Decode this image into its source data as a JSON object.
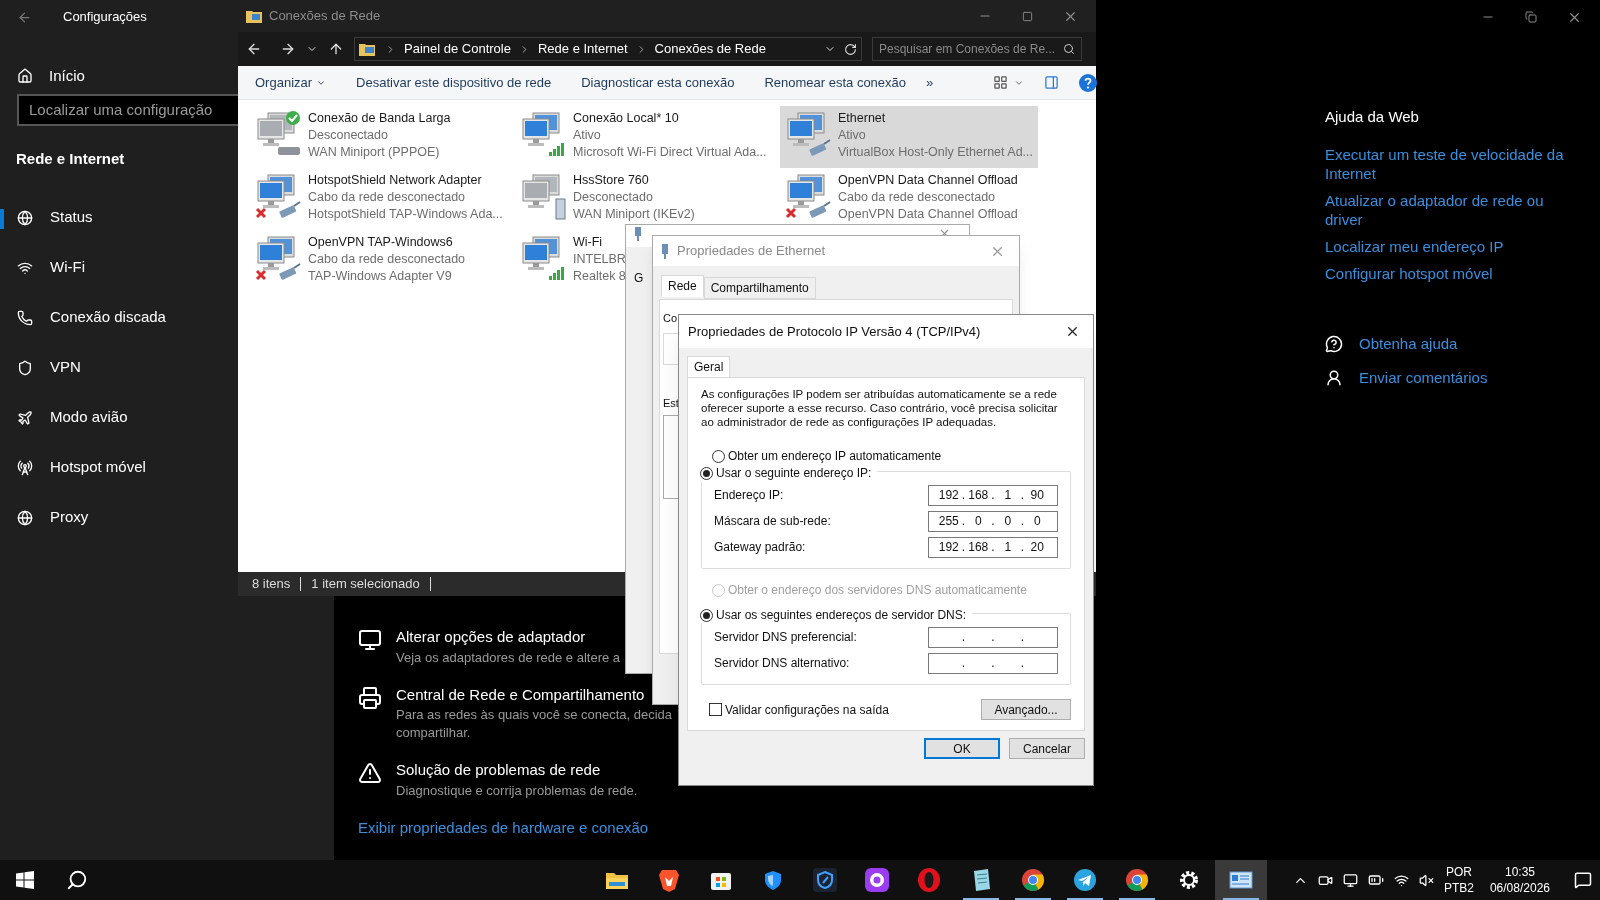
{
  "settings": {
    "title": "Configurações",
    "home": "Início",
    "search": {
      "placeholder": "Localizar uma configuração"
    },
    "section": "Rede e Internet",
    "nav": [
      {
        "label": "Status",
        "selected": true
      },
      {
        "label": "Wi-Fi",
        "selected": false
      },
      {
        "label": "Conexão discada",
        "selected": false
      },
      {
        "label": "VPN",
        "selected": false
      },
      {
        "label": "Modo avião",
        "selected": false
      },
      {
        "label": "Hotspot móvel",
        "selected": false
      },
      {
        "label": "Proxy",
        "selected": false
      }
    ],
    "related": [
      {
        "title": "Alterar opções de adaptador",
        "lines": [
          "Veja os adaptadores de rede e altere a"
        ]
      },
      {
        "title": "Central de Rede e Compartilhamento",
        "lines": [
          "Para as redes às quais você se conecta, decida",
          "compartilhar."
        ]
      },
      {
        "title": "Solução de problemas de rede",
        "lines": [
          "Diagnostique e corrija problemas de rede."
        ]
      }
    ],
    "link": "Exibir propriedades de hardware e conexão",
    "help": {
      "title": "Ajuda da Web",
      "links": [
        "Executar um teste de velocidade da Internet",
        "Atualizar o adaptador de rede ou driver",
        "Localizar meu endereço IP",
        "Configurar hotspot móvel"
      ],
      "actions": [
        "Obtenha ajuda",
        "Enviar comentários"
      ]
    }
  },
  "explorer": {
    "title": "Conexões de Rede",
    "breadcrumb": [
      "Painel de Controle",
      "Rede e Internet",
      "Conexões de Rede"
    ],
    "search": {
      "placeholder": "Pesquisar em Conexões de Re..."
    },
    "toolbar": [
      "Organizar",
      "Desativar este dispositivo de rede",
      "Diagnosticar esta conexão",
      "Renomear esta conexão"
    ],
    "more": "»",
    "connections": [
      {
        "name": "Conexão de Banda Larga",
        "status": "Desconectado",
        "device": "WAN Miniport (PPPOE)",
        "kind": "modem",
        "is_default": true,
        "cable_unplugged": false,
        "selected": false
      },
      {
        "name": "Conexão Local* 10",
        "status": "Ativo",
        "device": "Microsoft Wi-Fi Direct Virtual Ada...",
        "kind": "signal",
        "is_default": false,
        "cable_unplugged": false,
        "selected": false
      },
      {
        "name": "Ethernet",
        "status": "Ativo",
        "device": "VirtualBox Host-Only Ethernet Ad...",
        "kind": "cable",
        "is_default": false,
        "cable_unplugged": false,
        "selected": true
      },
      {
        "name": "HotspotShield Network Adapter",
        "status": "Cabo da rede desconectado",
        "device": "HotspotShield TAP-Windows Ada...",
        "kind": "cable",
        "is_default": false,
        "cable_unplugged": true,
        "selected": false
      },
      {
        "name": "HssStore 760",
        "status": "Desconectado",
        "device": "WAN Miniport (IKEv2)",
        "kind": "server",
        "is_default": false,
        "cable_unplugged": false,
        "selected": false
      },
      {
        "name": "OpenVPN Data Channel Offload",
        "status": "Cabo da rede desconectado",
        "device": "OpenVPN Data Channel Offload",
        "kind": "cable",
        "is_default": false,
        "cable_unplugged": true,
        "selected": false
      },
      {
        "name": "OpenVPN TAP-Windows6",
        "status": "Cabo da rede desconectado",
        "device": "TAP-Windows Adapter V9",
        "kind": "cable",
        "is_default": false,
        "cable_unplugged": true,
        "selected": false
      },
      {
        "name": "Wi-Fi",
        "status": "INTELBR",
        "device": "Realtek 8",
        "kind": "signal",
        "is_default": false,
        "cable_unplugged": false,
        "selected": false
      }
    ],
    "status_bar": [
      "8 itens",
      "1 item selecionado"
    ]
  },
  "status_dialog": {
    "tab": "G"
  },
  "ethernet_dialog": {
    "title": "Propriedades de Ethernet",
    "tabs": [
      {
        "label": "Rede",
        "selected": true
      },
      {
        "label": "Compartilhamento",
        "selected": false
      }
    ],
    "partial_labels": [
      "Co",
      "Est"
    ]
  },
  "ipv4_dialog": {
    "title": "Propriedades de Protocolo IP Versão 4 (TCP/IPv4)",
    "tabs": [
      {
        "label": "Geral",
        "selected": true
      }
    ],
    "intro": "As configurações IP podem ser atribuídas automaticamente se a rede oferecer suporte a esse recurso. Caso contrário, você precisa solicitar ao administrador de rede as configurações IP adequadas.",
    "ip_mode": [
      {
        "label": "Obter um endereço IP automaticamente",
        "selected": false,
        "disabled": false
      },
      {
        "label": "Usar o seguinte endereço IP:",
        "selected": true,
        "disabled": false
      }
    ],
    "ip_fields": [
      {
        "label": "Endereço IP:",
        "separator": ".",
        "octets": [
          "192",
          "168",
          "1",
          "90"
        ]
      },
      {
        "label": "Máscara de sub-rede:",
        "separator": ".",
        "octets": [
          "255",
          "0",
          "0",
          "0"
        ]
      },
      {
        "label": "Gateway padrão:",
        "separator": ".",
        "octets": [
          "192",
          "168",
          "1",
          "20"
        ]
      }
    ],
    "dns_mode": [
      {
        "label": "Obter o endereço dos servidores DNS automaticamente",
        "selected": false,
        "disabled": true
      },
      {
        "label": "Usar os seguintes endereços de servidor DNS:",
        "selected": true,
        "disabled": false
      }
    ],
    "dns_fields": [
      {
        "label": "Servidor DNS preferencial:",
        "separator": "."
      },
      {
        "label": "Servidor DNS alternativo:",
        "separator": "."
      }
    ],
    "validate": {
      "label": "Validar configurações na saída",
      "checked": false
    },
    "advanced": "Avançado...",
    "ok": "OK",
    "cancel": "Cancelar"
  },
  "taskbar": {
    "apps": [
      {
        "kind": "folder",
        "running": false,
        "active": false
      },
      {
        "kind": "lion",
        "running": false,
        "active": false
      },
      {
        "kind": "store",
        "running": false,
        "active": false
      },
      {
        "kind": "shield",
        "running": false,
        "active": false
      },
      {
        "kind": "vpn",
        "running": false,
        "active": false
      },
      {
        "kind": "purple",
        "running": false,
        "active": false
      },
      {
        "kind": "opera",
        "running": false,
        "active": false
      },
      {
        "kind": "notepad",
        "running": true,
        "active": false
      },
      {
        "kind": "chrome",
        "running": true,
        "active": false
      },
      {
        "kind": "telegram",
        "running": true,
        "active": false
      },
      {
        "kind": "chrome",
        "running": true,
        "active": false
      },
      {
        "kind": "gear",
        "running": false,
        "active": false
      },
      {
        "kind": "panel",
        "running": true,
        "active": true
      }
    ],
    "language": [
      "POR",
      "PTB2"
    ],
    "time": "10:35",
    "date": "06/08/2026"
  }
}
